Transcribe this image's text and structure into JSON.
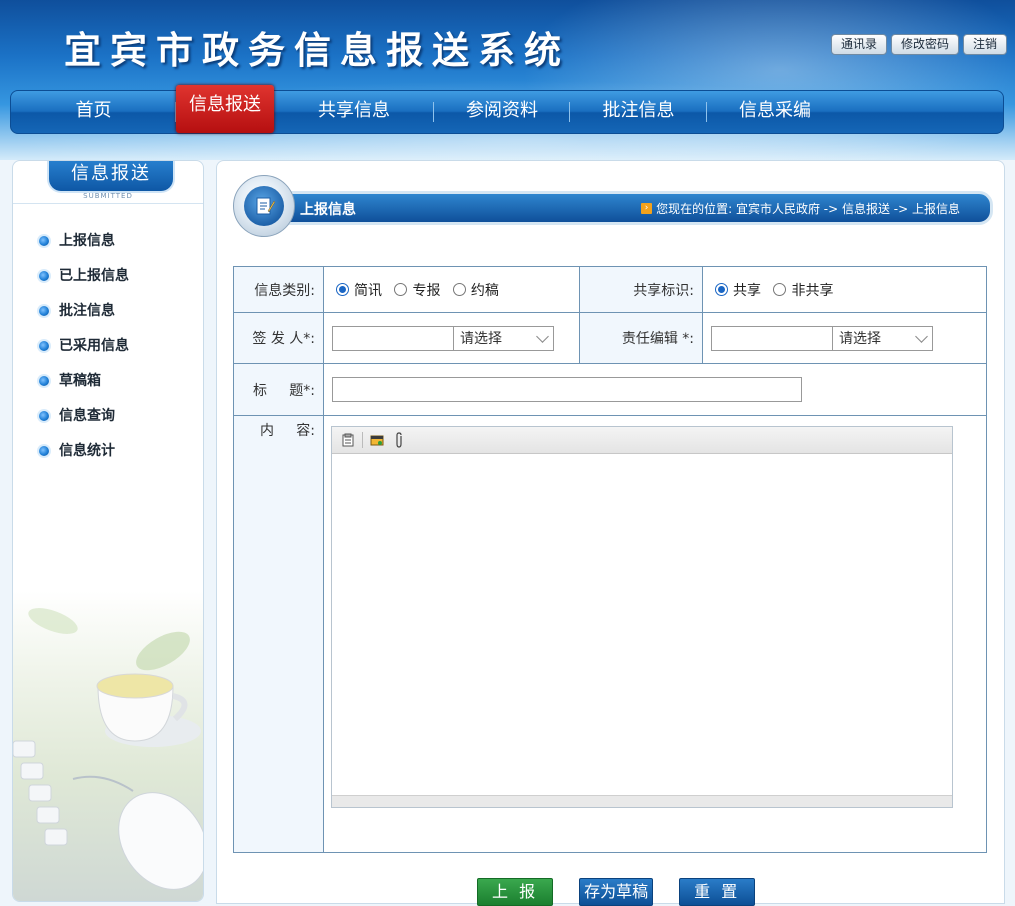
{
  "site": {
    "title": "宜宾市政务信息报送系统",
    "top_links": [
      {
        "label": "通讯录"
      },
      {
        "label": "修改密码"
      },
      {
        "label": "注销"
      }
    ]
  },
  "nav": {
    "items": [
      {
        "label": "首页",
        "active": false
      },
      {
        "label": "信息报送",
        "active": true
      },
      {
        "label": "共享信息",
        "active": false
      },
      {
        "label": "参阅资料",
        "active": false
      },
      {
        "label": "批注信息",
        "active": false
      },
      {
        "label": "信息采编",
        "active": false
      }
    ]
  },
  "sidebar": {
    "title": "信息报送",
    "subtitle": "SUBMITTED",
    "items": [
      {
        "label": "上报信息"
      },
      {
        "label": "已上报信息"
      },
      {
        "label": "批注信息"
      },
      {
        "label": "已采用信息"
      },
      {
        "label": "草稿箱"
      },
      {
        "label": "信息查询"
      },
      {
        "label": "信息统计"
      }
    ]
  },
  "page": {
    "title": "上报信息",
    "breadcrumb": "您现在的位置: 宜宾市人民政府 -> 信息报送 -> 上报信息"
  },
  "form": {
    "category_label": "信息类别:",
    "category_options": [
      "简讯",
      "专报",
      "约稿"
    ],
    "category_selected": "简讯",
    "share_label": "共享标识:",
    "share_options": [
      "共享",
      "非共享"
    ],
    "share_selected": "共享",
    "signer_label": "签 发 人*:",
    "signer_value": "",
    "signer_select": "请选择",
    "editor_label": "责任编辑 *:",
    "editor_value": "",
    "editor_select": "请选择",
    "title_label": "标     题*:",
    "title_value": "",
    "content_label": "内     容:"
  },
  "actions": {
    "submit": "上 报",
    "save_draft": "存为草稿",
    "reset": "重 置"
  },
  "colors": {
    "accent_blue": "#1a6fc0",
    "active_red": "#c91a1a",
    "submit_green": "#1b7f2f"
  }
}
